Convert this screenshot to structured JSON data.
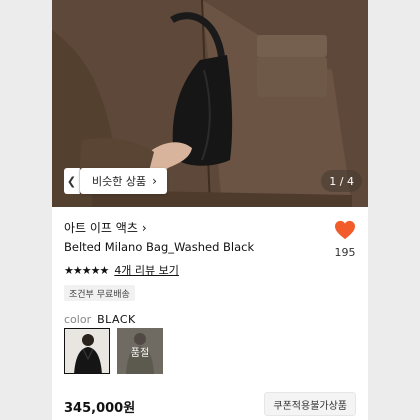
{
  "gallery": {
    "similar_button_label": "비슷한 상품",
    "counter": "1 / 4",
    "left_tab_glyph": "❮"
  },
  "product": {
    "brand": "아트 이프 액츠",
    "brand_chevron": "›",
    "name": "Belted Milano Bag_Washed Black",
    "rating_stars": "★★★★★",
    "rating_value": 5,
    "review_link": "4개 리뷰 보기",
    "like_count": "195",
    "heart_color": "#f25c2a",
    "shipping_badge": "조건부 무료배송"
  },
  "options": {
    "color_label": "color",
    "color_value": "BLACK",
    "swatches": [
      {
        "name": "black",
        "selected": true,
        "sold_out_text": ""
      },
      {
        "name": "olive",
        "selected": false,
        "sold_out_text": "품절"
      }
    ]
  },
  "purchase": {
    "price": "345,000원",
    "coupon_label": "쿠폰적용불가상품"
  }
}
